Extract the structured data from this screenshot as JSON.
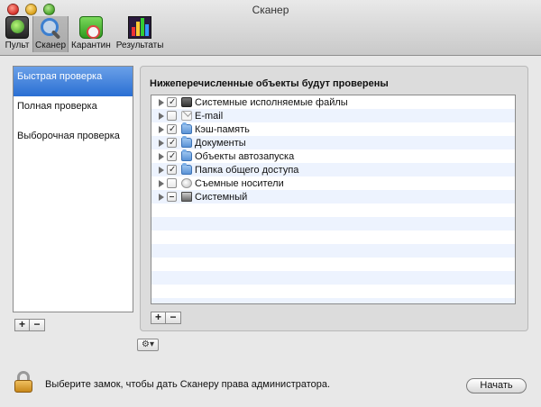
{
  "window": {
    "title": "Сканер"
  },
  "toolbar": {
    "items": [
      {
        "label": "Пульт",
        "icon": "console-icon",
        "selected": false
      },
      {
        "label": "Сканер",
        "icon": "scanner-magnifier-icon",
        "selected": true
      },
      {
        "label": "Карантин",
        "icon": "quarantine-icon",
        "selected": false
      },
      {
        "label": "Результаты",
        "icon": "results-chart-icon",
        "selected": false
      }
    ]
  },
  "scan_types": {
    "items": [
      {
        "label": "Быстрая проверка",
        "selected": true
      },
      {
        "label": "Полная проверка",
        "selected": false
      },
      {
        "label": "Выборочная проверка",
        "selected": false
      }
    ],
    "add_label": "+",
    "remove_label": "−"
  },
  "objects": {
    "title": "Нижеперечисленные объекты будут проверены",
    "rows": [
      {
        "label": "Системные исполняемые файлы",
        "check": "checked",
        "icon": "system-files-icon"
      },
      {
        "label": "E-mail",
        "check": "unchecked",
        "icon": "email-icon"
      },
      {
        "label": "Кэш-память",
        "check": "checked",
        "icon": "folder-icon"
      },
      {
        "label": "Документы",
        "check": "checked",
        "icon": "folder-icon"
      },
      {
        "label": "Объекты автозапуска",
        "check": "checked",
        "icon": "folder-icon"
      },
      {
        "label": "Папка общего доступа",
        "check": "checked",
        "icon": "folder-icon"
      },
      {
        "label": "Съемные носители",
        "check": "unchecked",
        "icon": "removable-media-icon"
      },
      {
        "label": "Системный",
        "check": "mixed",
        "icon": "system-disk-icon"
      }
    ],
    "add_label": "+",
    "remove_label": "−"
  },
  "actions_menu": {
    "icon": "gear-icon",
    "label": "⚙▾"
  },
  "footer": {
    "lock_icon": "lock-icon",
    "lock_text": "Выберите замок, чтобы дать Сканеру права администратора.",
    "start_label": "Начать"
  },
  "colors": {
    "selection": "#2a6fd3",
    "row_stripe": "#edf3fe",
    "window_bg": "#e8e8e8"
  }
}
